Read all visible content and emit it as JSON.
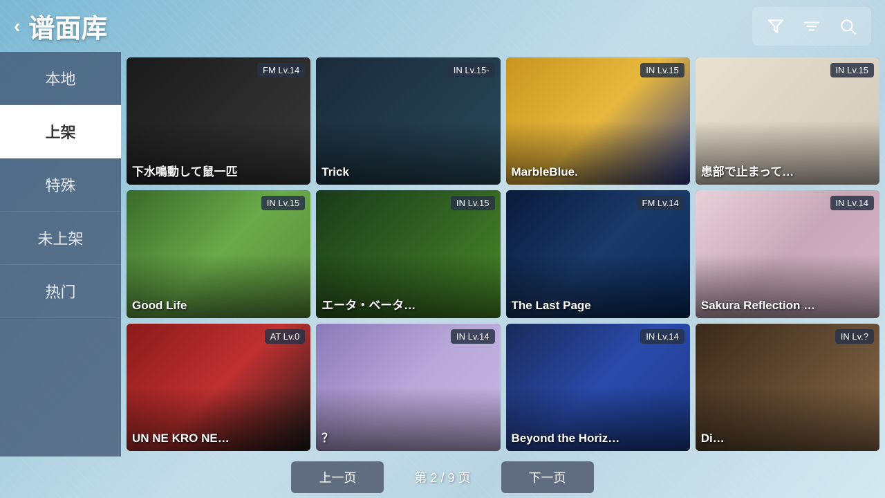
{
  "header": {
    "back_label": "‹",
    "title": "谱面库",
    "filter_icon": "filter",
    "sort_icon": "sort",
    "search_icon": "search"
  },
  "sidebar": {
    "items": [
      {
        "id": "local",
        "label": "本地",
        "active": false
      },
      {
        "id": "online",
        "label": "上架",
        "active": true
      },
      {
        "id": "special",
        "label": "特殊",
        "active": false
      },
      {
        "id": "unlisted",
        "label": "未上架",
        "active": false
      },
      {
        "id": "hot",
        "label": "热门",
        "active": false
      }
    ]
  },
  "grid": {
    "cards": [
      {
        "id": 1,
        "badge": "FM  Lv.14",
        "title": "下水鳴動して鼠一匹",
        "class": "card-1"
      },
      {
        "id": 2,
        "badge": "IN  Lv.15-",
        "title": "Trick",
        "class": "card-2"
      },
      {
        "id": 3,
        "badge": "IN  Lv.15",
        "title": "MarbleBlue.",
        "class": "card-3"
      },
      {
        "id": 4,
        "badge": "IN  Lv.15",
        "title": "患部で止まって…",
        "class": "card-4"
      },
      {
        "id": 5,
        "badge": "IN  Lv.15",
        "title": "Good Life",
        "class": "card-5"
      },
      {
        "id": 6,
        "badge": "IN  Lv.15",
        "title": "エータ・ベータ…",
        "class": "card-6"
      },
      {
        "id": 7,
        "badge": "FM  Lv.14",
        "title": "The Last Page",
        "class": "card-7"
      },
      {
        "id": 8,
        "badge": "IN  Lv.14",
        "title": "Sakura Reflection …",
        "class": "card-8"
      },
      {
        "id": 9,
        "badge": "AT  Lv.0",
        "title": "UN NE KRO NE…",
        "class": "card-9"
      },
      {
        "id": 10,
        "badge": "IN  Lv.14",
        "title": "？",
        "class": "card-10"
      },
      {
        "id": 11,
        "badge": "IN  Lv.14",
        "title": "Beyond the Horiz…",
        "class": "card-11"
      },
      {
        "id": 12,
        "badge": "IN  Lv.?",
        "title": "Di…",
        "class": "card-12"
      }
    ]
  },
  "footer": {
    "prev_label": "上一页",
    "page_info": "第 2 / 9 页",
    "next_label": "下一页"
  }
}
